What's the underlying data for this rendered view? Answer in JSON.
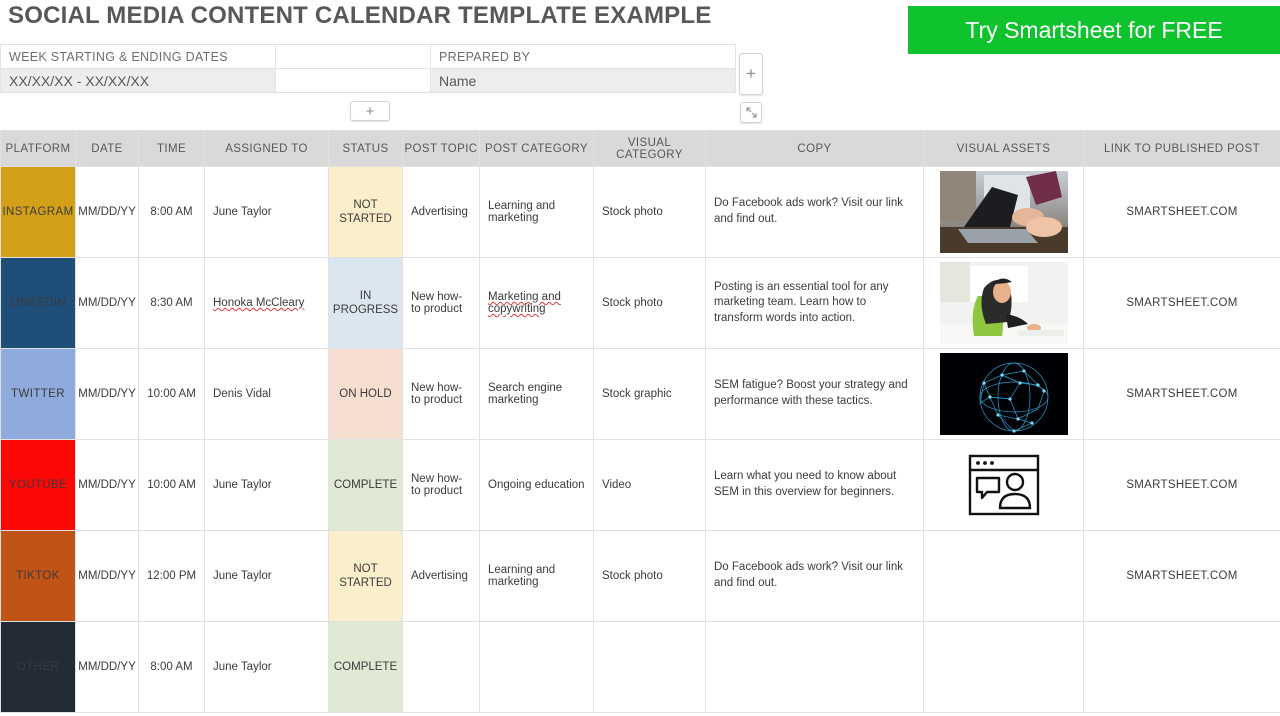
{
  "header": {
    "title": "SOCIAL MEDIA CONTENT CALENDAR TEMPLATE EXAMPLE",
    "cta_label": "Try Smartsheet for FREE",
    "cta_color": "#0ec32e"
  },
  "meta": {
    "week_label": "WEEK STARTING & ENDING DATES",
    "week_value": "XX/XX/XX - XX/XX/XX",
    "prepared_label": "PREPARED BY",
    "prepared_value": "Name",
    "add_row_label": "+",
    "add_col_label": "+",
    "expand_icon": "expand-arrows-icon"
  },
  "table": {
    "columns": [
      "PLATFORM",
      "DATE",
      "TIME",
      "ASSIGNED TO",
      "STATUS",
      "POST TOPIC",
      "POST CATEGORY",
      "VISUAL CATEGORY",
      "COPY",
      "VISUAL ASSETS",
      "LINK TO PUBLISHED POST"
    ],
    "rows": [
      {
        "platform": "INSTAGRAM",
        "platform_color": "#d4a017",
        "date": "MM/DD/YY",
        "time": "8:00 AM",
        "assigned_to": "June Taylor",
        "assigned_misspelled": false,
        "status": "NOT STARTED",
        "status_color": "#fbeecb",
        "post_topic": "Advertising",
        "post_category": "Learning and marketing",
        "category_misspelled": false,
        "visual_category": "Stock photo",
        "copy": "Do Facebook ads work? Visit our link and find out.",
        "visual_asset": "photo-laptop-hands",
        "link": "SMARTSHEET.COM"
      },
      {
        "platform": "LINKEDIN",
        "platform_color": "#1f4e79",
        "date": "MM/DD/YY",
        "time": "8:30 AM",
        "assigned_to": "Honoka McCleary",
        "assigned_misspelled": true,
        "status": "IN PROGRESS",
        "status_color": "#dce6f1",
        "post_topic": "New how-to product",
        "post_category": "Marketing and copywriting",
        "category_misspelled": true,
        "visual_category": "Stock photo",
        "copy": "Posting is an essential tool for any marketing team. Learn how to transform words into action.",
        "visual_asset": "photo-woman-desk",
        "link": "SMARTSHEET.COM"
      },
      {
        "platform": "TWITTER",
        "platform_color": "#8fabde",
        "date": "MM/DD/YY",
        "time": "10:00 AM",
        "assigned_to": "Denis Vidal",
        "assigned_misspelled": false,
        "status": "ON HOLD",
        "status_color": "#f6ded0",
        "post_topic": "New how-to product",
        "post_category": "Search engine marketing",
        "category_misspelled": false,
        "visual_category": "Stock graphic",
        "copy": "SEM fatigue? Boost your strategy and performance with these tactics.",
        "visual_asset": "graphic-network-globe",
        "link": "SMARTSHEET.COM"
      },
      {
        "platform": "YOUTUBE",
        "platform_color": "#fd0707",
        "date": "MM/DD/YY",
        "time": "10:00 AM",
        "assigned_to": "June Taylor",
        "assigned_misspelled": false,
        "status": "COMPLETE",
        "status_color": "#dfe9d4",
        "post_topic": "New how-to product",
        "post_category": "Ongoing education",
        "category_misspelled": false,
        "visual_category": "Video",
        "copy": "Learn what you need to know about SEM in this overview for beginners.",
        "visual_asset": "webinar-window-icon",
        "link": "SMARTSHEET.COM"
      },
      {
        "platform": "TIKTOK",
        "platform_color": "#c25317",
        "date": "MM/DD/YY",
        "time": "12:00 PM",
        "assigned_to": "June Taylor",
        "assigned_misspelled": false,
        "status": "NOT STARTED",
        "status_color": "#fbeecb",
        "post_topic": "Advertising",
        "post_category": "Learning and marketing",
        "category_misspelled": false,
        "visual_category": "Stock photo",
        "copy": "Do Facebook ads work? Visit our link and find out.",
        "visual_asset": "",
        "link": "SMARTSHEET.COM"
      },
      {
        "platform": "OTHER",
        "platform_color": "#222b36",
        "date": "MM/DD/YY",
        "time": "8:00 AM",
        "assigned_to": "June Taylor",
        "assigned_misspelled": false,
        "status": "COMPLETE",
        "status_color": "#dfe9d4",
        "post_topic": "",
        "post_category": "",
        "category_misspelled": false,
        "visual_category": "",
        "copy": "",
        "visual_asset": "",
        "link": ""
      }
    ]
  }
}
